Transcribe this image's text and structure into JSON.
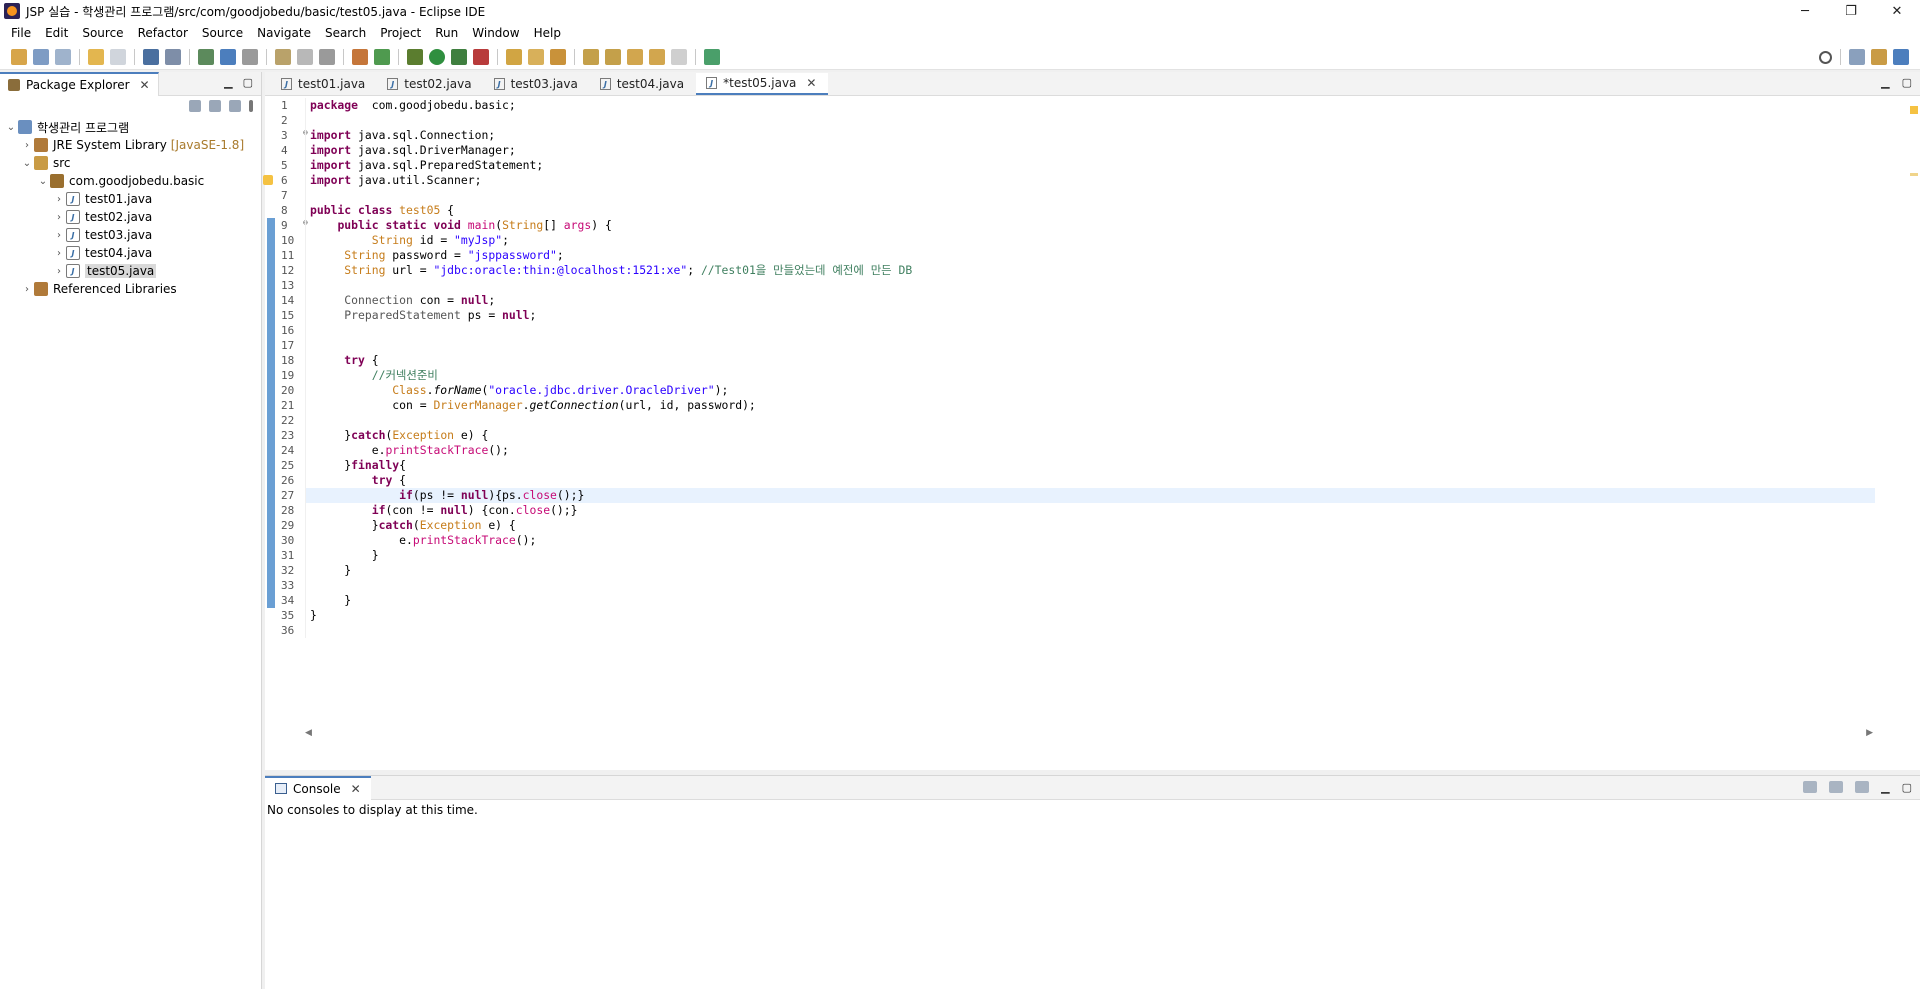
{
  "window": {
    "title": "JSP 실습 - 학생관리 프로그램/src/com/goodjobedu/basic/test05.java - Eclipse IDE",
    "controls": [
      "─",
      "❐",
      "✕"
    ]
  },
  "menu": [
    "File",
    "Edit",
    "Source",
    "Refactor",
    "Source",
    "Navigate",
    "Search",
    "Project",
    "Run",
    "Window",
    "Help"
  ],
  "package_explorer": {
    "tab_label": "Package Explorer",
    "tree": [
      {
        "indent": 0,
        "chev": "⌄",
        "icon": "project",
        "label": "학생관리 프로그램",
        "extra": ""
      },
      {
        "indent": 1,
        "chev": "›",
        "icon": "lib",
        "label": "JRE System Library",
        "extra": "[JavaSE-1.8]"
      },
      {
        "indent": 1,
        "chev": "⌄",
        "icon": "src",
        "label": "src",
        "extra": ""
      },
      {
        "indent": 2,
        "chev": "⌄",
        "icon": "pkg",
        "label": "com.goodjobedu.basic",
        "extra": ""
      },
      {
        "indent": 3,
        "chev": "›",
        "icon": "java",
        "label": "test01.java",
        "extra": ""
      },
      {
        "indent": 3,
        "chev": "›",
        "icon": "java",
        "label": "test02.java",
        "extra": ""
      },
      {
        "indent": 3,
        "chev": "›",
        "icon": "java",
        "label": "test03.java",
        "extra": ""
      },
      {
        "indent": 3,
        "chev": "›",
        "icon": "java",
        "label": "test04.java",
        "extra": ""
      },
      {
        "indent": 3,
        "chev": "›",
        "icon": "java",
        "label": "test05.java",
        "extra": "",
        "selected": true
      },
      {
        "indent": 1,
        "chev": "›",
        "icon": "lib",
        "label": "Referenced Libraries",
        "extra": ""
      }
    ]
  },
  "editor": {
    "tabs": [
      {
        "label": "test01.java",
        "active": false
      },
      {
        "label": "test02.java",
        "active": false
      },
      {
        "label": "test03.java",
        "active": false
      },
      {
        "label": "test04.java",
        "active": false
      },
      {
        "label": "*test05.java",
        "active": true
      }
    ],
    "highlight_line": 27,
    "lines": [
      [
        [
          "kw",
          "package"
        ],
        [
          "",
          "  com.goodjobedu.basic;"
        ]
      ],
      [],
      [
        [
          "kw",
          "import"
        ],
        [
          "",
          " java.sql.Connection;"
        ]
      ],
      [
        [
          "kw",
          "import"
        ],
        [
          "",
          " java.sql.DriverManager;"
        ]
      ],
      [
        [
          "kw",
          "import"
        ],
        [
          "",
          " java.sql.PreparedStatement;"
        ]
      ],
      [
        [
          "kw",
          "import"
        ],
        [
          "",
          " java.util.Scanner;"
        ]
      ],
      [],
      [
        [
          "kw",
          "public"
        ],
        [
          "",
          " "
        ],
        [
          "kw",
          "class"
        ],
        [
          "",
          " "
        ],
        [
          "ty",
          "test05"
        ],
        [
          "",
          " {"
        ]
      ],
      [
        [
          "",
          "    "
        ],
        [
          "kw",
          "public"
        ],
        [
          "",
          " "
        ],
        [
          "kw",
          "static"
        ],
        [
          "",
          " "
        ],
        [
          "kw",
          "void"
        ],
        [
          "",
          " "
        ],
        [
          "mth",
          "main"
        ],
        [
          "",
          "("
        ],
        [
          "ty",
          "String"
        ],
        [
          "",
          "[] "
        ],
        [
          "mth",
          "args"
        ],
        [
          "",
          ") {"
        ]
      ],
      [
        [
          "",
          "         "
        ],
        [
          "ty",
          "String"
        ],
        [
          "",
          " id = "
        ],
        [
          "str",
          "\"myJsp\""
        ],
        [
          "",
          ";"
        ]
      ],
      [
        [
          "",
          "     "
        ],
        [
          "ty",
          "String"
        ],
        [
          "",
          " password = "
        ],
        [
          "str",
          "\"jsppassword\""
        ],
        [
          "",
          ";"
        ]
      ],
      [
        [
          "",
          "     "
        ],
        [
          "ty",
          "String"
        ],
        [
          "",
          " url = "
        ],
        [
          "str",
          "\"jdbc:oracle:thin:@localhost:1521:xe\""
        ],
        [
          "",
          "; "
        ],
        [
          "cmt",
          "//Test01을 만들었는데 예전에 만든 DB"
        ]
      ],
      [],
      [
        [
          "",
          "     "
        ],
        [
          "fld",
          "Connection"
        ],
        [
          "",
          " con = "
        ],
        [
          "kw",
          "null"
        ],
        [
          "",
          ";"
        ]
      ],
      [
        [
          "",
          "     "
        ],
        [
          "fld",
          "PreparedStatement"
        ],
        [
          "",
          " ps = "
        ],
        [
          "kw",
          "null"
        ],
        [
          "",
          ";"
        ]
      ],
      [],
      [],
      [
        [
          "",
          "     "
        ],
        [
          "kw",
          "try"
        ],
        [
          "",
          " {"
        ]
      ],
      [
        [
          "",
          "         "
        ],
        [
          "cmt",
          "//커넥션준비"
        ]
      ],
      [
        [
          "",
          "            "
        ],
        [
          "ty",
          "Class"
        ],
        [
          "",
          "."
        ],
        [
          "it",
          "forName"
        ],
        [
          "",
          "("
        ],
        [
          "str",
          "\"oracle.jdbc.driver.OracleDriver\""
        ],
        [
          "",
          ");"
        ]
      ],
      [
        [
          "",
          "            con = "
        ],
        [
          "ty",
          "DriverManager"
        ],
        [
          "",
          "."
        ],
        [
          "it",
          "getConnection"
        ],
        [
          "",
          "(url, id, password);"
        ]
      ],
      [],
      [
        [
          "",
          "     }"
        ],
        [
          "kw",
          "catch"
        ],
        [
          "",
          "("
        ],
        [
          "ty",
          "Exception"
        ],
        [
          "",
          " e) {"
        ]
      ],
      [
        [
          "",
          "         e."
        ],
        [
          "mth",
          "printStackTrace"
        ],
        [
          "",
          "();"
        ]
      ],
      [
        [
          "",
          "     }"
        ],
        [
          "kw",
          "finally"
        ],
        [
          "",
          "{"
        ]
      ],
      [
        [
          "",
          "         "
        ],
        [
          "kw",
          "try"
        ],
        [
          "",
          " {"
        ]
      ],
      [
        [
          "",
          "             "
        ],
        [
          "kw",
          "if"
        ],
        [
          "",
          "(ps != "
        ],
        [
          "kw",
          "null"
        ],
        [
          "",
          ")"
        ],
        [
          "",
          "{ps."
        ],
        [
          "mth",
          "close"
        ],
        [
          "",
          "();}"
        ]
      ],
      [
        [
          "",
          "         "
        ],
        [
          "kw",
          "if"
        ],
        [
          "",
          "(con != "
        ],
        [
          "kw",
          "null"
        ],
        [
          "",
          ") {con."
        ],
        [
          "mth",
          "close"
        ],
        [
          "",
          "();}"
        ]
      ],
      [
        [
          "",
          "         }"
        ],
        [
          "kw",
          "catch"
        ],
        [
          "",
          "("
        ],
        [
          "ty",
          "Exception"
        ],
        [
          "",
          " e) {"
        ]
      ],
      [
        [
          "",
          "             e."
        ],
        [
          "mth",
          "printStackTrace"
        ],
        [
          "",
          "();"
        ]
      ],
      [
        [
          "",
          "         }"
        ]
      ],
      [
        [
          "",
          "     }"
        ]
      ],
      [],
      [
        [
          "",
          "     }"
        ]
      ],
      [
        [
          "",
          "}"
        ]
      ],
      []
    ]
  },
  "console": {
    "tab_label": "Console",
    "message": "No consoles to display at this time."
  }
}
